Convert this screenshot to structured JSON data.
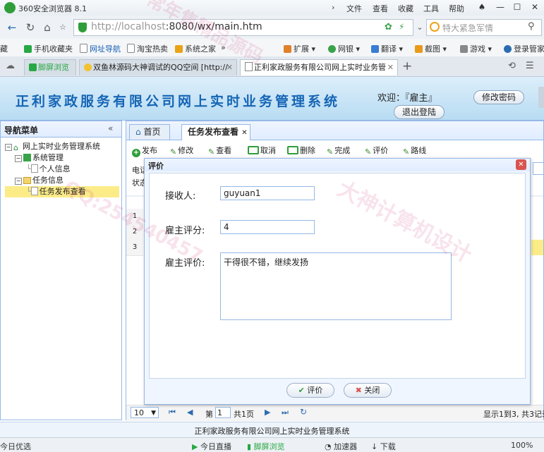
{
  "browser": {
    "app_title": "360安全浏览器 8.1",
    "menu": [
      "文件",
      "查看",
      "收藏",
      "工具",
      "帮助"
    ],
    "url_host": "http://localhost",
    "url_rest": ":8080/wx/main.htm",
    "search_placeholder": "特大紧急军情",
    "bookmarks": [
      "藏",
      "手机收藏夹",
      "网址导航",
      "淘宝热卖",
      "系统之家"
    ],
    "bookmark_tools": [
      "扩展",
      "网银",
      "翻译",
      "截图",
      "游戏",
      "登录管家"
    ],
    "tabs": [
      {
        "label": "脚屏浏览"
      },
      {
        "label": "双鱼林源码大神调试的QQ空间 [http://"
      },
      {
        "label": "正利家政服务有限公司网上实时业务管"
      }
    ]
  },
  "app": {
    "title": "正利家政服务有限公司网上实时业务管理系统",
    "welcome": "欢迎：『雇主』",
    "change_password": "修改密码",
    "logout": "退出登陆",
    "footer": "正利家政服务有限公司网上实时业务管理系统"
  },
  "sidebar": {
    "title": "导航菜单",
    "collapse": "«",
    "tree": {
      "root": "网上实时业务管理系统",
      "group1": "系统管理",
      "item1": "个人信息",
      "group2": "任务信息",
      "item2": "任务发布查看"
    }
  },
  "main": {
    "tabs": [
      "首页",
      "任务发布查看"
    ],
    "toolbar": [
      "发布",
      "修改",
      "查看",
      "取消",
      "删除",
      "完成",
      "评价",
      "路线"
    ],
    "filter_labels": [
      "电话",
      "状态"
    ],
    "rows": [
      "1",
      "2",
      "3"
    ],
    "pager": {
      "page_size": "10",
      "page_prefix": "第",
      "page_value": "1",
      "page_suffix": "共1页",
      "info": "显示1到3, 共3记录"
    }
  },
  "dialog": {
    "title": "评价",
    "close": "✕",
    "fields": {
      "receiver_label": "接收人:",
      "receiver_value": "guyuan1",
      "score_label": "雇主评分:",
      "score_value": "4",
      "comment_label": "雇主评价:",
      "comment_value": "干得很不错，继续发扬"
    },
    "buttons": {
      "ok": "评价",
      "close": "关闭"
    }
  },
  "statusbar": {
    "left": "今日优选",
    "items": [
      "今日直播",
      "脚屏浏览",
      "加速器",
      "下载"
    ],
    "zoom": "100%"
  },
  "watermark": {
    "texts": [
      "常年售精品源码",
      "大神计算机设计",
      "QQ:254540457"
    ]
  },
  "colors": {
    "brand_blue": "#1565b5",
    "panel_border": "#95b8e7",
    "selected_node": "#fbec88",
    "close_red": "#d9534f"
  }
}
